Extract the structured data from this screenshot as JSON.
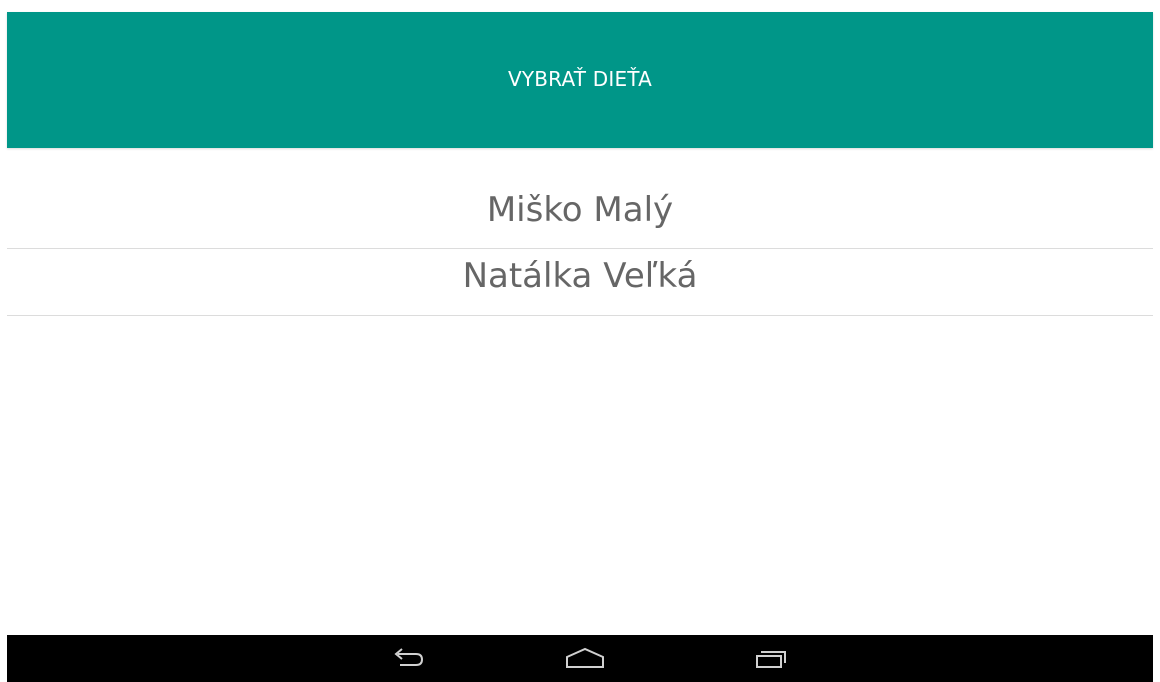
{
  "app_bar": {
    "title": "VYBRAŤ DIEŤA",
    "color": "#009688"
  },
  "children": [
    {
      "name": "Miško Malý"
    },
    {
      "name": "Natálka Veľká"
    }
  ],
  "nav_bar": {
    "buttons": [
      {
        "icon": "back-icon"
      },
      {
        "icon": "home-icon"
      },
      {
        "icon": "recent-apps-icon"
      }
    ]
  }
}
